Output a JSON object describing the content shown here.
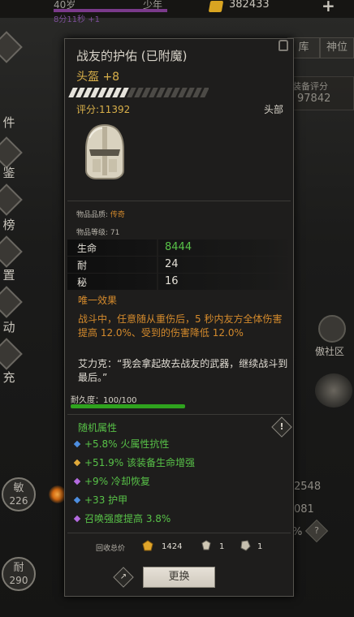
{
  "topbar": {
    "age": "40岁",
    "stage": "少年",
    "timer": "8分11秒 +1",
    "gold": "382433",
    "plus": "+"
  },
  "left_rail": [
    {
      "label": "件",
      "icon": "bag-icon"
    },
    {
      "label": "鉴",
      "icon": "scroll-icon"
    },
    {
      "label": "榜",
      "icon": "ranking-icon"
    },
    {
      "label": "置",
      "icon": "settings-icon"
    },
    {
      "label": "动",
      "icon": "event-icon"
    },
    {
      "label": "充",
      "icon": "recharge-icon"
    }
  ],
  "right_tabs": [
    "库",
    "神位"
  ],
  "right_panel": {
    "score_label": "装备评分",
    "score_value": "97842",
    "mask_label": "傲社区",
    "num1": "2548",
    "num2": "081",
    "pct": "%",
    "help": "?"
  },
  "stat_circles": [
    {
      "key": "敏",
      "value": "226"
    },
    {
      "key": "耐",
      "value": "290"
    }
  ],
  "item": {
    "name": "战友的护佑 (已附魔)",
    "slot_type": "头盔 +8",
    "score": "评分:11392",
    "slot": "头部",
    "quality_label": "物品品质: ",
    "quality_value": "传奇",
    "level": "物品等级: 71",
    "stats": [
      {
        "key": "生命",
        "value": "8444",
        "highlight": true
      },
      {
        "key": "耐",
        "value": "24",
        "highlight": false
      },
      {
        "key": "秘",
        "value": "16",
        "highlight": false
      }
    ],
    "unique_heading": "唯一效果",
    "unique_desc": "战斗中，任意随从重伤后，5 秒内友方全体伤害提高 12.0%、受到的伤害降低 12.0%",
    "quote": "艾力克：“我会拿起故去战友的武器，继续战斗到最后。”",
    "durability": "耐久度：100/100",
    "durability_fraction": 1.0,
    "random_heading": "随机属性",
    "warn_icon": "!",
    "attributes": [
      {
        "text": "+5.8% 火属性抗性",
        "dot_color": "#4d8ee0"
      },
      {
        "text": "+51.9% 该装备生命增强",
        "dot_color": "#e0a93a"
      },
      {
        "text": "+9% 冷却恢复",
        "dot_color": "#b46be0"
      },
      {
        "text": "+33 护甲",
        "dot_color": "#4d8ee0"
      },
      {
        "text": "召唤强度提高 3.8%",
        "dot_color": "#b46be0"
      }
    ],
    "recycle_label": "回收总价",
    "recycle": [
      {
        "icon": "gold-ore-icon",
        "value": "1424"
      },
      {
        "icon": "crystal-icon",
        "value": "1"
      },
      {
        "icon": "stone-icon",
        "value": "1"
      }
    ],
    "share_icon": "↗",
    "swap_button": "更换"
  }
}
